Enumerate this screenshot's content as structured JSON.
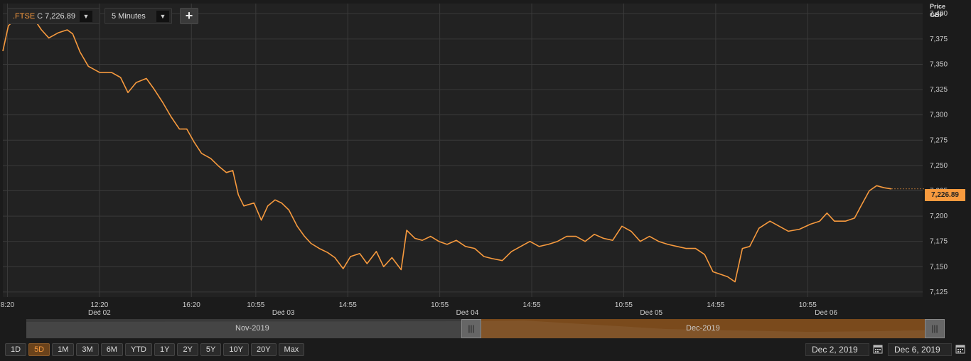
{
  "toolbar": {
    "symbol": ".FTSE",
    "close_flag": "C",
    "last_value": "7,226.89",
    "interval": "5 Minutes",
    "dropdown_icon": "▼",
    "add_label": "+"
  },
  "axis": {
    "title_line1": "Price",
    "title_line2": "GBP",
    "current_price_label": "7,226.89"
  },
  "navigator": {
    "left_label": "Nov-2019",
    "right_label": "Dec-2019"
  },
  "range_buttons": [
    "1D",
    "5D",
    "1M",
    "3M",
    "6M",
    "YTD",
    "1Y",
    "2Y",
    "5Y",
    "10Y",
    "20Y",
    "Max"
  ],
  "active_range": "5D",
  "date_range": {
    "from": "Dec 2, 2019",
    "to": "Dec 6, 2019"
  },
  "colors": {
    "line": "#f79a3e",
    "background": "#222222",
    "grid": "#3a3a3a",
    "accent": "#f79a3e"
  },
  "chart_data": {
    "type": "line",
    "ylabel": "Price GBP",
    "ylim": [
      7120,
      7410
    ],
    "yticks": [
      7400,
      7375,
      7350,
      7325,
      7300,
      7275,
      7250,
      7225,
      7200,
      7175,
      7150,
      7125
    ],
    "ytick_labels": [
      "7,400",
      "7,375",
      "7,350",
      "7,325",
      "7,300",
      "7,275",
      "7,250",
      "7,225",
      "7,200",
      "7,175",
      "7,150",
      "7,125"
    ],
    "x_index_range": [
      0,
      100
    ],
    "time_ticks": [
      {
        "x": 0.5,
        "label": "8:20"
      },
      {
        "x": 10.5,
        "label": "12:20"
      },
      {
        "x": 20.5,
        "label": "16:20"
      },
      {
        "x": 27.5,
        "label": "10:55"
      },
      {
        "x": 37.5,
        "label": "14:55"
      },
      {
        "x": 47.5,
        "label": "10:55"
      },
      {
        "x": 57.5,
        "label": "14:55"
      },
      {
        "x": 67.5,
        "label": "10:55"
      },
      {
        "x": 77.5,
        "label": "14:55"
      },
      {
        "x": 87.5,
        "label": "10:55"
      }
    ],
    "day_ticks": [
      {
        "x": 10.5,
        "label": "Dec 02"
      },
      {
        "x": 30.5,
        "label": "Dec 03"
      },
      {
        "x": 50.5,
        "label": "Dec 04"
      },
      {
        "x": 70.5,
        "label": "Dec 05"
      },
      {
        "x": 89.5,
        "label": "Dec 06"
      }
    ],
    "series": [
      {
        "values": [
          [
            0,
            7363
          ],
          [
            0.6,
            7388
          ],
          [
            1.5,
            7396
          ],
          [
            2.5,
            7399
          ],
          [
            3.3,
            7396
          ],
          [
            4.2,
            7384
          ],
          [
            5,
            7376
          ],
          [
            6,
            7381
          ],
          [
            7,
            7384
          ],
          [
            7.6,
            7380
          ],
          [
            8.4,
            7362
          ],
          [
            9.3,
            7348
          ],
          [
            10.5,
            7342
          ],
          [
            11.8,
            7342
          ],
          [
            12.8,
            7337
          ],
          [
            13.6,
            7322
          ],
          [
            14.5,
            7332
          ],
          [
            15.6,
            7336
          ],
          [
            16.4,
            7326
          ],
          [
            17.4,
            7312
          ],
          [
            18.3,
            7298
          ],
          [
            19.2,
            7286
          ],
          [
            20,
            7286
          ],
          [
            20.8,
            7273
          ],
          [
            21.6,
            7262
          ],
          [
            22.6,
            7257
          ],
          [
            23.5,
            7249
          ],
          [
            24.3,
            7243
          ],
          [
            25,
            7245
          ],
          [
            25.6,
            7221
          ],
          [
            26.2,
            7210
          ],
          [
            27.3,
            7213
          ],
          [
            28.1,
            7196
          ],
          [
            28.8,
            7210
          ],
          [
            29.6,
            7216
          ],
          [
            30.3,
            7213
          ],
          [
            31.1,
            7206
          ],
          [
            32,
            7190
          ],
          [
            32.8,
            7180
          ],
          [
            33.5,
            7173
          ],
          [
            34.4,
            7168
          ],
          [
            35.3,
            7164
          ],
          [
            36.1,
            7159
          ],
          [
            37,
            7148
          ],
          [
            37.8,
            7160
          ],
          [
            38.8,
            7163
          ],
          [
            39.6,
            7153
          ],
          [
            40.6,
            7165
          ],
          [
            41.4,
            7150
          ],
          [
            42.3,
            7159
          ],
          [
            43.3,
            7147
          ],
          [
            43.9,
            7186
          ],
          [
            44.8,
            7178
          ],
          [
            45.6,
            7176
          ],
          [
            46.5,
            7180
          ],
          [
            47.4,
            7175
          ],
          [
            48.3,
            7172
          ],
          [
            49.3,
            7176
          ],
          [
            50.3,
            7170
          ],
          [
            51.3,
            7168
          ],
          [
            52.3,
            7160
          ],
          [
            53.2,
            7158
          ],
          [
            54.3,
            7156
          ],
          [
            55.3,
            7165
          ],
          [
            56.3,
            7170
          ],
          [
            57.3,
            7175
          ],
          [
            58.3,
            7170
          ],
          [
            59.3,
            7172
          ],
          [
            60.3,
            7175
          ],
          [
            61.3,
            7180
          ],
          [
            62.3,
            7180
          ],
          [
            63.3,
            7175
          ],
          [
            64.3,
            7182
          ],
          [
            65.3,
            7178
          ],
          [
            66.3,
            7176
          ],
          [
            67.3,
            7190
          ],
          [
            68.3,
            7185
          ],
          [
            69.3,
            7175
          ],
          [
            70.3,
            7180
          ],
          [
            71.3,
            7175
          ],
          [
            72.3,
            7172
          ],
          [
            73.3,
            7170
          ],
          [
            74.3,
            7168
          ],
          [
            75.3,
            7168
          ],
          [
            76.3,
            7162
          ],
          [
            77.2,
            7145
          ],
          [
            78.2,
            7142
          ],
          [
            78.8,
            7140
          ],
          [
            79.6,
            7135
          ],
          [
            80.4,
            7168
          ],
          [
            81.2,
            7170
          ],
          [
            82.2,
            7188
          ],
          [
            83.4,
            7195
          ],
          [
            84.4,
            7190
          ],
          [
            85.4,
            7185
          ],
          [
            86.6,
            7187
          ],
          [
            87.8,
            7192
          ],
          [
            88.8,
            7195
          ],
          [
            89.6,
            7203
          ],
          [
            90.4,
            7195
          ],
          [
            91.6,
            7195
          ],
          [
            92.6,
            7198
          ],
          [
            93.3,
            7210
          ],
          [
            94.2,
            7225
          ],
          [
            95,
            7230
          ],
          [
            95.8,
            7228
          ],
          [
            96.6,
            7226.89
          ]
        ]
      }
    ]
  }
}
